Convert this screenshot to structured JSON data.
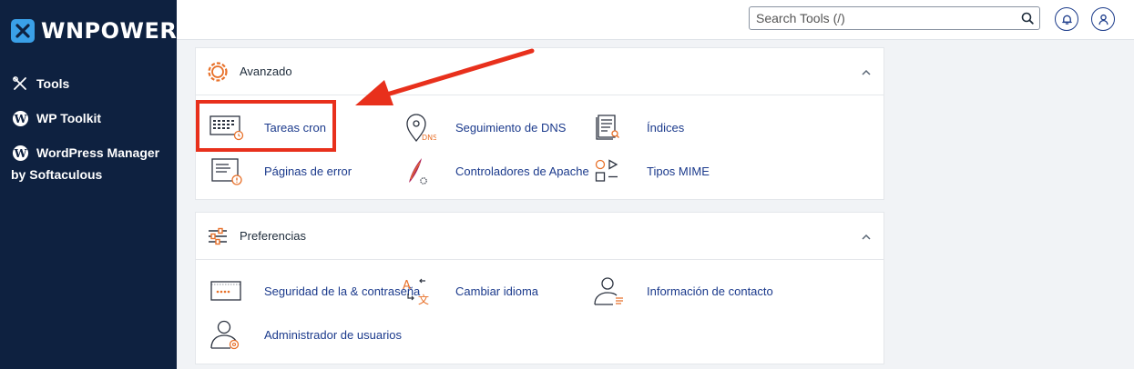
{
  "sidebar": {
    "brand": "WNPOWER",
    "items": [
      {
        "label": "Tools",
        "icon": "tools-icon"
      },
      {
        "label": "WP Toolkit",
        "icon": "wordpress-icon"
      },
      {
        "label": "WordPress Manager",
        "sublabel": "by Softaculous",
        "icon": "wordpress-icon"
      }
    ]
  },
  "topbar": {
    "search_placeholder": "Search Tools (/)",
    "search_icon": "search-icon",
    "notifications_icon": "bell-icon",
    "user_icon": "user-icon"
  },
  "panels": [
    {
      "title": "Avanzado",
      "icon": "gear-icon",
      "tools": [
        {
          "label": "Tareas cron",
          "icon": "calendar-clock-icon"
        },
        {
          "label": "Seguimiento de DNS",
          "icon": "dns-pin-icon"
        },
        {
          "label": "Índices",
          "icon": "index-list-icon"
        },
        {
          "label": "Páginas de error",
          "icon": "error-page-icon"
        },
        {
          "label": "Controladores de Apache",
          "icon": "apache-feather-icon"
        },
        {
          "label": "Tipos MIME",
          "icon": "mime-shapes-icon"
        }
      ]
    },
    {
      "title": "Preferencias",
      "icon": "sliders-icon",
      "tools": [
        {
          "label": "Seguridad de la & contraseña",
          "icon": "password-icon"
        },
        {
          "label": "Cambiar idioma",
          "icon": "language-icon"
        },
        {
          "label": "Información de contacto",
          "icon": "contact-icon"
        },
        {
          "label": "Administrador de usuarios",
          "icon": "user-manager-icon"
        }
      ]
    }
  ],
  "colors": {
    "sidebar_bg": "#0e2140",
    "link": "#1b3a8c",
    "accent_orange": "#e8712a",
    "annotation_red": "#e8301c"
  }
}
